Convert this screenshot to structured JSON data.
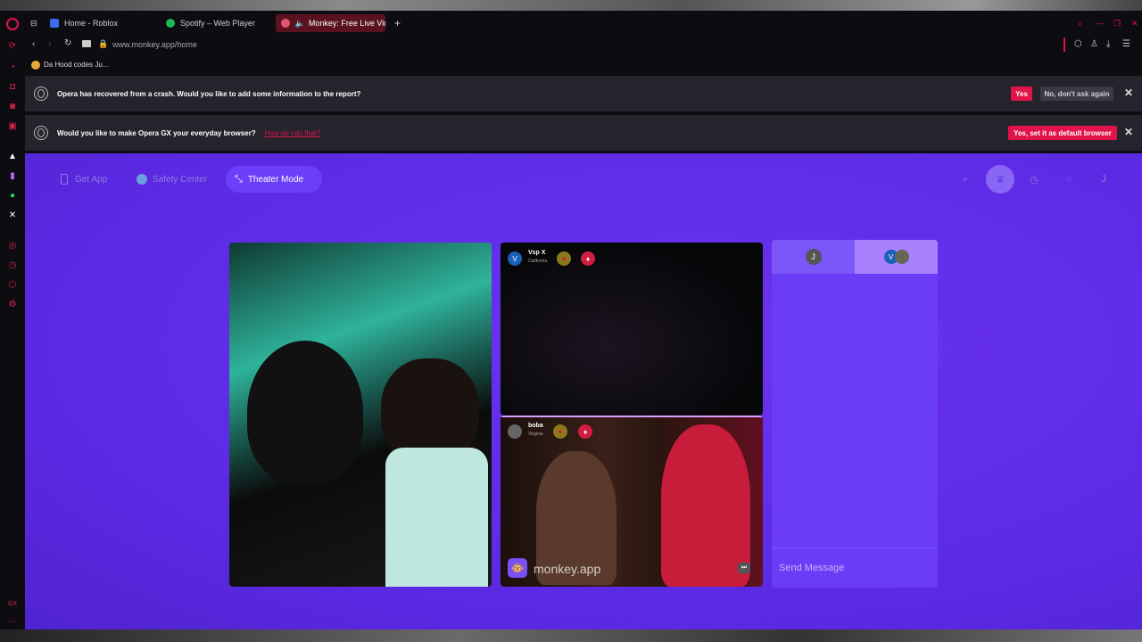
{
  "tabs": [
    {
      "label": "Home - Roblox"
    },
    {
      "label": "Spotify – Web Player"
    },
    {
      "label": "Monkey: Free Live Vid"
    }
  ],
  "address": {
    "url": "www.monkey.app/home"
  },
  "bookmarks": [
    {
      "label": "Da Hood codes Ju..."
    }
  ],
  "notices": {
    "crash": {
      "text": "Opera has recovered from a crash. Would you like to add some information to the report?",
      "yes": "Yes",
      "no": "No, don't ask again"
    },
    "default": {
      "text": "Would you like to make Opera GX your everyday browser?",
      "link": "How do I do that?",
      "yes": "Yes, set it as default browser"
    }
  },
  "nav": {
    "get_app": "Get App",
    "safety": "Safety Center",
    "theater": "Theater Mode"
  },
  "participants": [
    {
      "name": "Vsp X",
      "location": "California",
      "avatar": "V"
    },
    {
      "name": "boba",
      "location": "Virginia"
    }
  ],
  "chat": {
    "tab1": "J",
    "tab2": "V",
    "placeholder": "Send Message"
  },
  "watermark": "monkey.app",
  "account": {
    "initial": "J"
  },
  "colors": {
    "accent": "#e0134a",
    "page_bg": "#5b29e2",
    "chat_bg": "#6a3cf5"
  }
}
